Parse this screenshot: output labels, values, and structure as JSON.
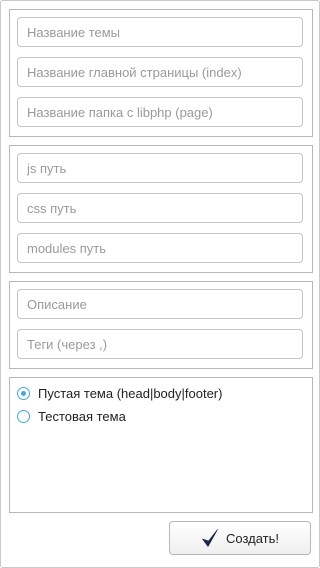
{
  "group_theme": {
    "fields": [
      {
        "placeholder": "Название темы",
        "value": ""
      },
      {
        "placeholder": "Название главной страницы (index)",
        "value": ""
      },
      {
        "placeholder": "Название папка с libphp (page)",
        "value": ""
      }
    ]
  },
  "group_paths": {
    "fields": [
      {
        "placeholder": "js путь",
        "value": ""
      },
      {
        "placeholder": "css путь",
        "value": ""
      },
      {
        "placeholder": "modules путь",
        "value": ""
      }
    ]
  },
  "group_meta": {
    "fields": [
      {
        "placeholder": "Описание",
        "value": ""
      },
      {
        "placeholder": "Теги (через ,)",
        "value": ""
      }
    ]
  },
  "template_options": {
    "selected": 0,
    "items": [
      {
        "label": "Пустая тема (head|body|footer)"
      },
      {
        "label": "Тестовая тема"
      }
    ]
  },
  "create_button": {
    "label": "Создать!",
    "icon": "checkmark-icon"
  },
  "colors": {
    "accent": "#45a8d8",
    "border": "#b8b8b8",
    "placeholder": "#9a9a9a"
  }
}
